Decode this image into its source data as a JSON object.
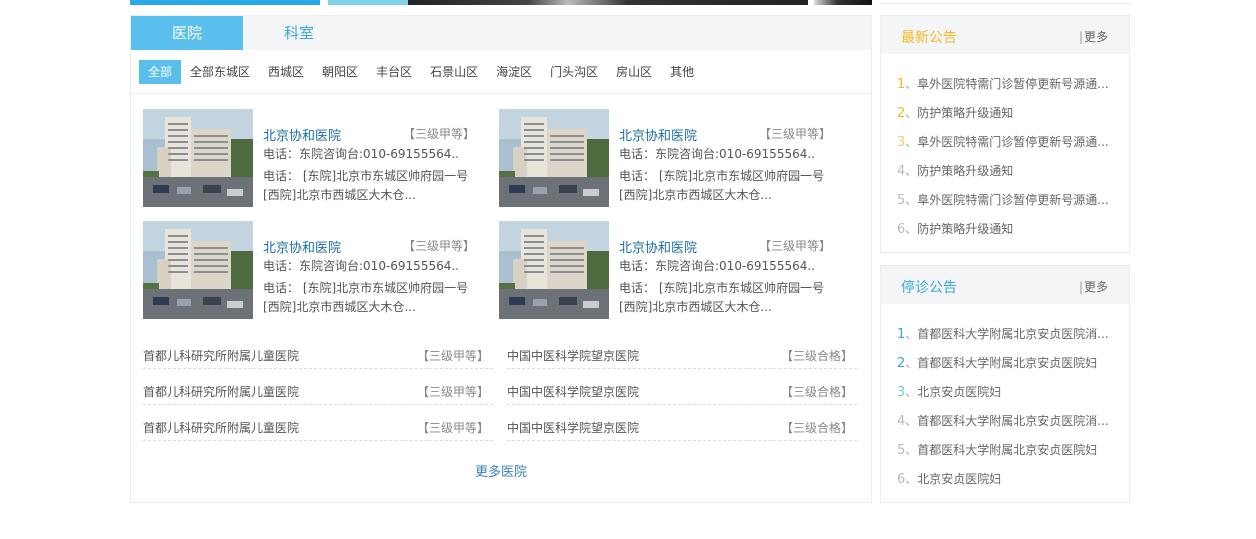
{
  "tabs": {
    "hospital": "医院",
    "department": "科室"
  },
  "filters": [
    "全部",
    "全部东城区",
    "西城区",
    "朝阳区",
    "丰台区",
    "石景山区",
    "海淀区",
    "门头沟区",
    "房山区",
    "其他"
  ],
  "cards": [
    {
      "name": "北京协和医院",
      "level": "【三级甲等】",
      "phone": "电话：东院咨询台:010-69155564..",
      "addr1": "电话： [东院]北京市东城区帅府园一号",
      "addr2": "[西院]北京市西城区大木仓..."
    },
    {
      "name": "北京协和医院",
      "level": "【三级甲等】",
      "phone": "电话：东院咨询台:010-69155564..",
      "addr1": "电话： [东院]北京市东城区帅府园一号",
      "addr2": "[西院]北京市西城区大木仓..."
    },
    {
      "name": "北京协和医院",
      "level": "【三级甲等】",
      "phone": "电话：东院咨询台:010-69155564..",
      "addr1": "电话： [东院]北京市东城区帅府园一号",
      "addr2": "[西院]北京市西城区大木仓..."
    },
    {
      "name": "北京协和医院",
      "level": "【三级甲等】",
      "phone": "电话：东院咨询台:010-69155564..",
      "addr1": "电话： [东院]北京市东城区帅府园一号",
      "addr2": "[西院]北京市西城区大木仓..."
    }
  ],
  "hospital_list": [
    {
      "left_name": "首都儿科研究所附属儿童医院",
      "left_level": "【三级甲等】",
      "right_name": "中国中医科学院望京医院",
      "right_level": "【三级合格】"
    },
    {
      "left_name": "首都儿科研究所附属儿童医院",
      "left_level": "【三级甲等】",
      "right_name": "中国中医科学院望京医院",
      "right_level": "【三级合格】"
    },
    {
      "left_name": "首都儿科研究所附属儿童医院",
      "left_level": "【三级甲等】",
      "right_name": "中国中医科学院望京医院",
      "right_level": "【三级合格】"
    }
  ],
  "more_hospitals": "更多医院",
  "latest_notices": {
    "title": "最新公告",
    "more": "更多",
    "title_color": "#f5b922",
    "items": [
      {
        "num": "1",
        "text": "阜外医院特需门诊暂停更新号源通..."
      },
      {
        "num": "2",
        "text": "防护策略升级通知"
      },
      {
        "num": "3",
        "text": "阜外医院特需门诊暂停更新号源通..."
      },
      {
        "num": "4",
        "text": "防护策略升级通知"
      },
      {
        "num": "5",
        "text": "阜外医院特需门诊暂停更新号源通..."
      },
      {
        "num": "6",
        "text": "防护策略升级通知"
      }
    ]
  },
  "closure_notices": {
    "title": "停诊公告",
    "more": "更多",
    "title_color": "#3aa6d9",
    "items": [
      {
        "num": "1",
        "text": "首都医科大学附属北京安贞医院消..."
      },
      {
        "num": "2",
        "text": "首都医科大学附属北京安贞医院妇"
      },
      {
        "num": "3",
        "text": "北京安贞医院妇"
      },
      {
        "num": "4",
        "text": "首都医科大学附属北京安贞医院消..."
      },
      {
        "num": "5",
        "text": "首都医科大学附属北京安贞医院妇"
      },
      {
        "num": "6",
        "text": "北京安贞医院妇"
      }
    ]
  }
}
